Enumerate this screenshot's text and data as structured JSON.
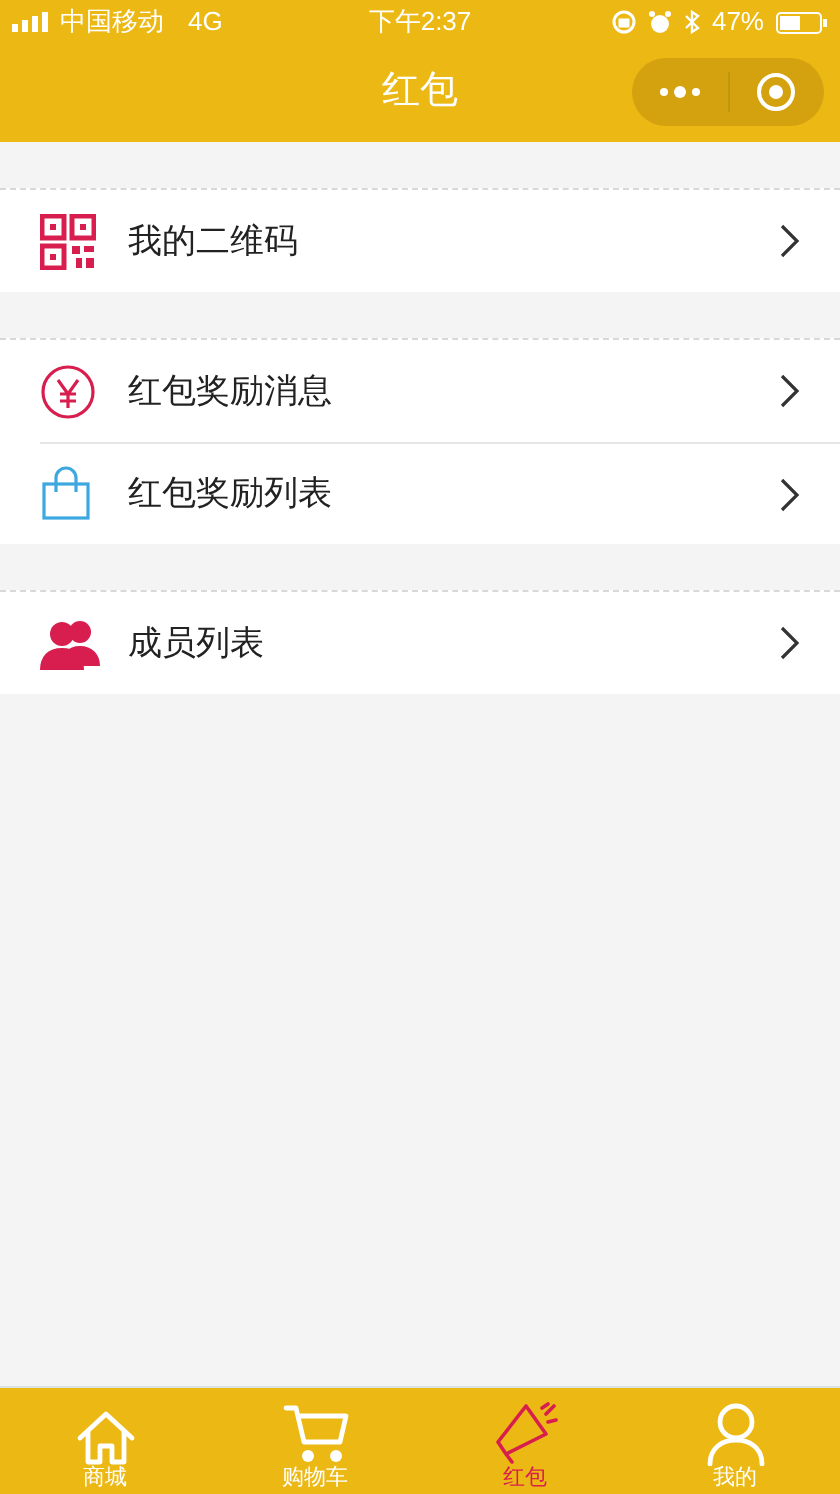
{
  "status_bar": {
    "carrier": "中国移动",
    "network": "4G",
    "time": "下午2:37",
    "battery": "47%"
  },
  "nav_bar": {
    "title": "红包"
  },
  "groups": [
    {
      "items": [
        {
          "label": "我的二维码"
        }
      ]
    },
    {
      "items": [
        {
          "label": "红包奖励消息"
        },
        {
          "label": "红包奖励列表"
        }
      ]
    },
    {
      "items": [
        {
          "label": "成员列表"
        }
      ]
    }
  ],
  "tab_bar": [
    {
      "label": "商城",
      "selected": false
    },
    {
      "label": "购物车",
      "selected": false
    },
    {
      "label": "红包",
      "selected": true
    },
    {
      "label": "我的",
      "selected": false
    }
  ]
}
